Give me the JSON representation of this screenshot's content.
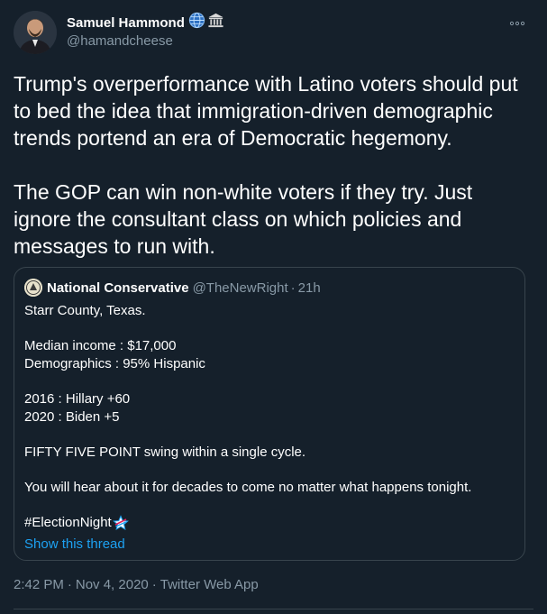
{
  "author": {
    "name": "Samuel Hammond",
    "handle": "@hamandcheese",
    "badges": [
      "globe-icon",
      "classical-building-icon"
    ]
  },
  "tweet": {
    "paragraphs": [
      "Trump's overperformance with Latino voters should put to bed the idea that immigration-driven demographic trends portend an era of Democratic hegemony.",
      "The GOP can win non-white voters if they try. Just ignore the consultant class on which policies and messages to run with."
    ]
  },
  "quoted_tweet": {
    "name": "National Conservative",
    "handle": "@TheNewRight",
    "dot": "·",
    "time": "21h",
    "lines": {
      "county": "Starr County, Texas.",
      "income": "Median income : $17,000",
      "demographics": "Demographics : 95% Hispanic",
      "y2016": "2016 : Hillary +60",
      "y2020": "2020 : Biden +5",
      "swing": "FIFTY FIVE POINT swing within a single cycle.",
      "hear": "You will hear about it for decades to come no matter what happens tonight.",
      "hashtag": "#ElectionNight"
    },
    "show_thread": "Show this thread"
  },
  "meta": {
    "time": "2:42 PM",
    "date": "Nov 4, 2020",
    "source": "Twitter Web App",
    "sep": "·"
  },
  "colors": {
    "background": "#15202b",
    "secondary_text": "#8899a6",
    "link": "#1da1f2",
    "border": "#38444d"
  }
}
